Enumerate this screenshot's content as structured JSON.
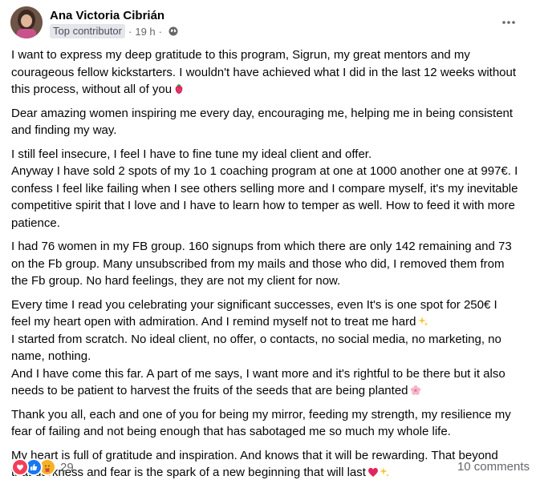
{
  "post": {
    "author": "Ana Victoria Cibrián",
    "badge": "Top contributor",
    "time": "19 h",
    "separator": "·",
    "privacy_icon": "globe-icon",
    "more_icon": "more-horizontal-icon",
    "paragraphs": [
      {
        "lines": [
          "I want to express my deep gratitude to this program, Sigrun, my great mentors and my",
          "courageous fellow kickstarters. I wouldn't have achieved what I did in the last 12 weeks without",
          "this process, without all of you"
        ],
        "emoji": "strawberry-emoji"
      },
      {
        "lines": [
          "Dear amazing women inspiring me every day, encouraging me, helping me in being consistent",
          "and finding my way."
        ]
      },
      {
        "lines": [
          "I still feel insecure, I feel I have to fine tune my ideal client and offer.",
          "Anyway I have sold 2 spots of my 1o 1 coaching program at  one at 1000 another one at 997€. I",
          "confess I feel like failing when I see others selling more and I compare myself, it's my inevitable",
          "competitive spirit that I love and I have to learn how to temper as well. How to feed it with more",
          "patience."
        ]
      },
      {
        "lines": [
          "I had 76 women in my FB group. 160 signups from which there are only 142 remaining and 73",
          "on the Fb group. Many unsubscribed from my mails and those who did, I removed them from",
          "the Fb group. No hard feelings, they are not my client for now."
        ]
      },
      {
        "lines": [
          "Every time I read you celebrating your significant successes, even It's is  one spot for 250€ I",
          "feel my heart open with admiration. And I remind myself not to treat me hard",
          "I started from scratch. No ideal client, no offer,  o contacts, no social media, no marketing, no",
          "name, nothing.",
          "And I have come this far. A part of me says, I want more and it's rightful to be there but it also",
          "needs to be patient to harvest the fruits of the seeds that are being planted"
        ]
      },
      {
        "lines": [
          "Thank you all, each and one of you for being my mirror, feeding my strength, my resilience my",
          "fear of failing and not being enough that has sabotaged me so much my whole life."
        ]
      },
      {
        "lines": [
          "My heart is full of gratitude and inspiration. And knows that it will be rewarding. That beyond",
          "that darkness and fear is the spark of a new beginning that will last"
        ]
      }
    ],
    "inline_emojis": [
      "sparkles-emoji",
      "cherry-blossom-emoji",
      "heart-sparkle-emoji"
    ]
  },
  "footer": {
    "reactions": [
      {
        "icon": "love-reaction-icon",
        "color": "#f33e58"
      },
      {
        "icon": "like-reaction-icon",
        "color": "#1877f2"
      },
      {
        "icon": "care-reaction-icon",
        "color": "#f7b125"
      }
    ],
    "reaction_count": "29",
    "comments_label": "10 comments"
  },
  "colors": {
    "text": "#050505",
    "secondary": "#65676b",
    "badge_bg": "#e4e6eb"
  }
}
